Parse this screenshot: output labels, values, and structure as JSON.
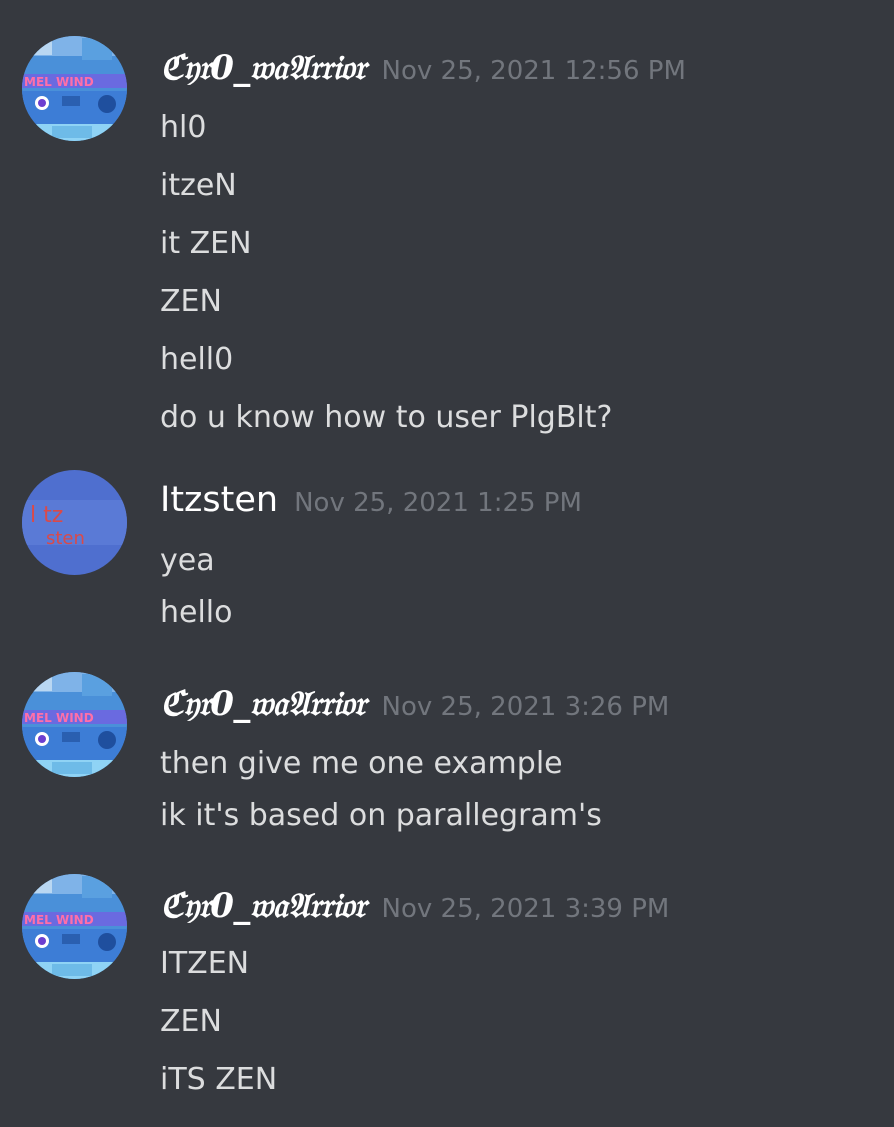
{
  "messages": [
    {
      "author": "ℭ𝔶𝔯0_𝔴𝔞𝔄𝔯𝔯𝔦𝔬𝔯",
      "timestamp": "Nov 25, 2021 12:56 PM",
      "avatar": "windows-collage-avatar",
      "lines": [
        "hl0",
        "itzeN",
        "it ZEN",
        "ZEN",
        "hell0",
        "do u know how to user PlgBlt?"
      ]
    },
    {
      "author": "Itzsten",
      "timestamp": "Nov 25, 2021 1:25 PM",
      "avatar": "itzsten-blue-avatar",
      "lines": [
        "yea",
        "hello"
      ]
    },
    {
      "author": "ℭ𝔶𝔯0_𝔴𝔞𝔄𝔯𝔯𝔦𝔬𝔯",
      "timestamp": "Nov 25, 2021 3:26 PM",
      "avatar": "windows-collage-avatar",
      "lines": [
        "then give me one example",
        "ik it's based on parallegram's"
      ]
    },
    {
      "author": "ℭ𝔶𝔯0_𝔴𝔞𝔄𝔯𝔯𝔦𝔬𝔯",
      "timestamp": "Nov 25, 2021 3:39 PM",
      "avatar": "windows-collage-avatar",
      "lines": [
        "ITZEN",
        "ZEN",
        "iTS ZEN"
      ]
    }
  ],
  "colors": {
    "background": "#36393f",
    "username": "#ffffff",
    "timestamp": "#72767d",
    "message_text": "#dcddde"
  }
}
